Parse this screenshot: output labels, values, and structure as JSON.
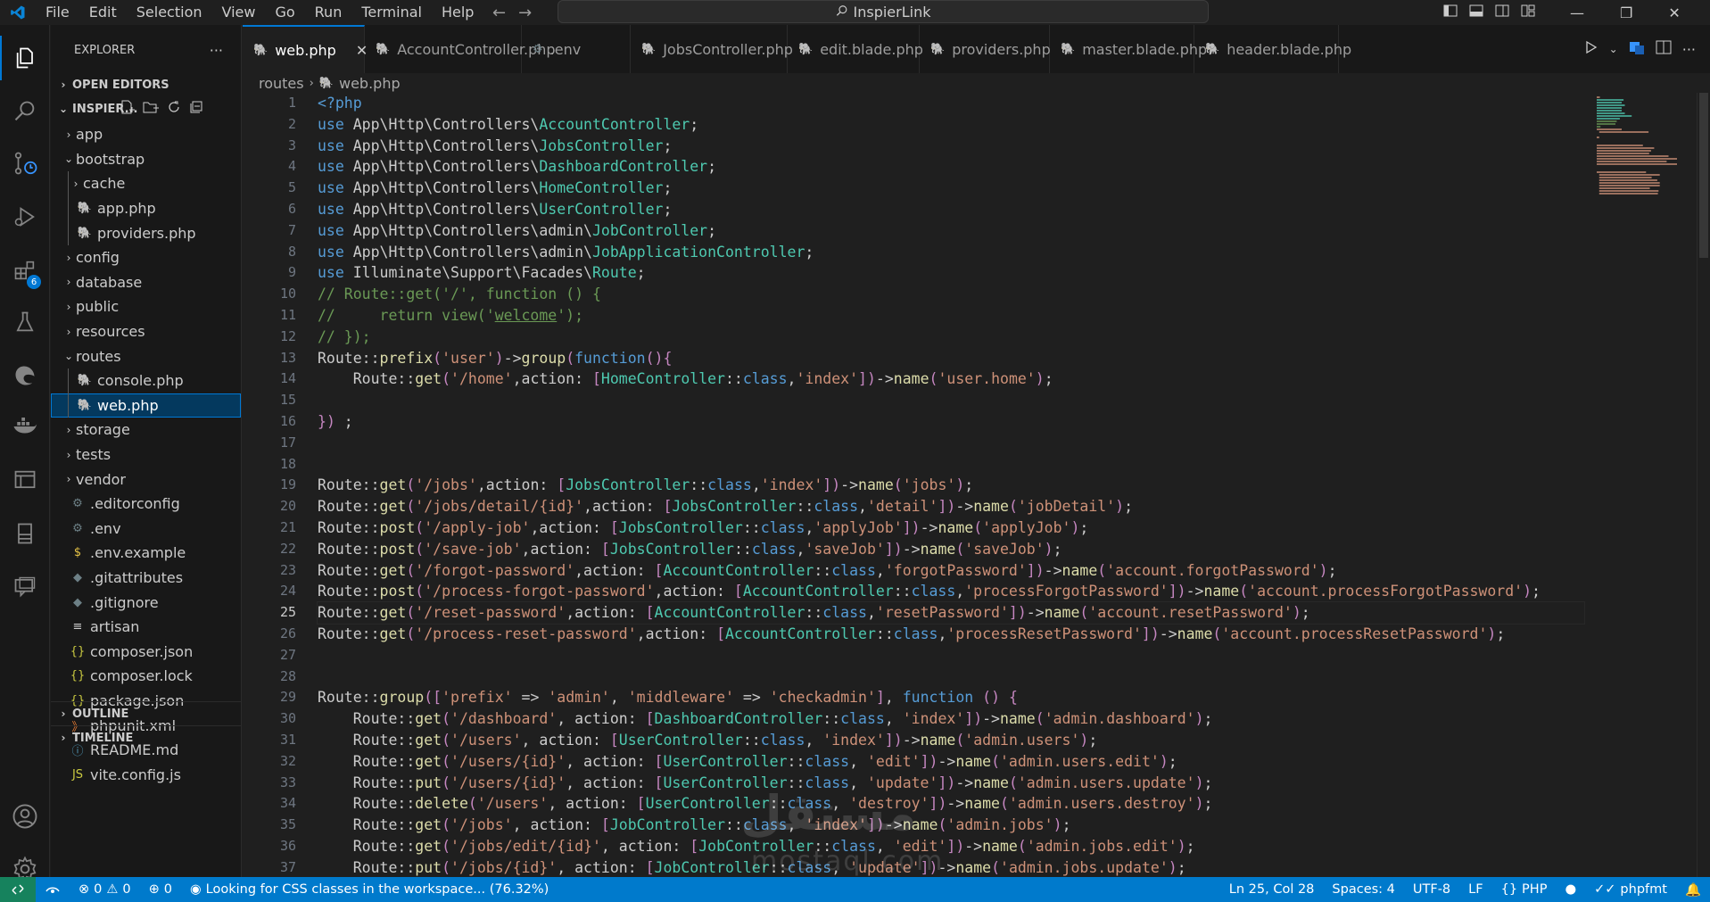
{
  "titlebar": {
    "menu": [
      "File",
      "Edit",
      "Selection",
      "View",
      "Go",
      "Run",
      "Terminal",
      "Help"
    ],
    "search_text": "InspierLink"
  },
  "activitybar": {
    "items": [
      "explorer-icon",
      "search-icon",
      "source-control-icon",
      "run-debug-icon",
      "extensions-icon",
      "testing-icon",
      "edge-icon",
      "docker-icon",
      "remote-explorer-icon",
      "database-icon",
      "chat-icon"
    ],
    "extensions_badge": "6",
    "bottom": [
      "account-icon",
      "settings-gear-icon"
    ]
  },
  "sidebar": {
    "title": "EXPLORER",
    "more": "···",
    "open_editors": "OPEN EDITORS",
    "folder": "INSPIER...",
    "tree": [
      {
        "label": "app",
        "type": "folder",
        "open": false,
        "depth": 0
      },
      {
        "label": "bootstrap",
        "type": "folder",
        "open": true,
        "depth": 0
      },
      {
        "label": "cache",
        "type": "folder",
        "open": false,
        "depth": 1
      },
      {
        "label": "app.php",
        "type": "php",
        "depth": 1
      },
      {
        "label": "providers.php",
        "type": "php",
        "depth": 1
      },
      {
        "label": "config",
        "type": "folder",
        "open": false,
        "depth": 0
      },
      {
        "label": "database",
        "type": "folder",
        "open": false,
        "depth": 0
      },
      {
        "label": "public",
        "type": "folder",
        "open": false,
        "depth": 0
      },
      {
        "label": "resources",
        "type": "folder",
        "open": false,
        "depth": 0
      },
      {
        "label": "routes",
        "type": "folder",
        "open": true,
        "depth": 0
      },
      {
        "label": "console.php",
        "type": "php",
        "depth": 1
      },
      {
        "label": "web.php",
        "type": "php",
        "depth": 1,
        "selected": true
      },
      {
        "label": "storage",
        "type": "folder",
        "open": false,
        "depth": 0
      },
      {
        "label": "tests",
        "type": "folder",
        "open": false,
        "depth": 0
      },
      {
        "label": "vendor",
        "type": "folder",
        "open": false,
        "depth": 0
      },
      {
        "label": ".editorconfig",
        "type": "gear",
        "depth": 0
      },
      {
        "label": ".env",
        "type": "gear",
        "depth": 0
      },
      {
        "label": ".env.example",
        "type": "dollar",
        "depth": 0
      },
      {
        "label": ".gitattributes",
        "type": "git",
        "depth": 0
      },
      {
        "label": ".gitignore",
        "type": "git",
        "depth": 0
      },
      {
        "label": "artisan",
        "type": "lines",
        "depth": 0
      },
      {
        "label": "composer.json",
        "type": "json",
        "depth": 0
      },
      {
        "label": "composer.lock",
        "type": "json",
        "depth": 0
      },
      {
        "label": "package.json",
        "type": "json",
        "depth": 0
      },
      {
        "label": "phpunit.xml",
        "type": "rss",
        "depth": 0
      },
      {
        "label": "README.md",
        "type": "info",
        "depth": 0
      },
      {
        "label": "vite.config.js",
        "type": "js",
        "depth": 0
      }
    ],
    "outline": "OUTLINE",
    "timeline": "TIMELINE"
  },
  "tabs": [
    {
      "label": "web.php",
      "active": true,
      "type": "php"
    },
    {
      "label": "AccountController.php",
      "type": "php"
    },
    {
      "label": ".env",
      "type": "gear"
    },
    {
      "label": "JobsController.php",
      "type": "php"
    },
    {
      "label": "edit.blade.php",
      "type": "php"
    },
    {
      "label": "providers.php",
      "type": "php"
    },
    {
      "label": "master.blade.php",
      "type": "php"
    },
    {
      "label": "header.blade.php",
      "type": "php"
    }
  ],
  "breadcrumb": {
    "folder": "routes",
    "file": "web.php"
  },
  "editor": {
    "current_line": 25,
    "lines": [
      "<?php",
      "use App\\Http\\Controllers\\AccountController;",
      "use App\\Http\\Controllers\\JobsController;",
      "use App\\Http\\Controllers\\DashboardController;",
      "use App\\Http\\Controllers\\HomeController;",
      "use App\\Http\\Controllers\\UserController;",
      "use App\\Http\\Controllers\\admin\\JobController;",
      "use App\\Http\\Controllers\\admin\\JobApplicationController;",
      "use Illuminate\\Support\\Facades\\Route;",
      "// Route::get('/', function () {",
      "//     return view('welcome');",
      "// });",
      "Route::prefix('user')->group(function(){",
      "    Route::get('/home',action: [HomeController::class,'index'])->name('user.home');",
      "",
      "}) ;",
      "",
      "",
      "Route::get('/jobs',action: [JobsController::class,'index'])->name('jobs');",
      "Route::get('/jobs/detail/{id}',action: [JobsController::class,'detail'])->name('jobDetail');",
      "Route::post('/apply-job',action: [JobsController::class,'applyJob'])->name('applyJob');",
      "Route::post('/save-job',action: [JobsController::class,'saveJob'])->name('saveJob');",
      "Route::get('/forgot-password',action: [AccountController::class,'forgotPassword'])->name('account.forgotPassword');",
      "Route::post('/process-forgot-password',action: [AccountController::class,'processForgotPassword'])->name('account.processForgotPassword');",
      "Route::get('/reset-password',action: [AccountController::class,'resetPassword'])->name('account.resetPassword');",
      "Route::get('/process-reset-password',action: [AccountController::class,'processResetPassword'])->name('account.processResetPassword');",
      "",
      "",
      "Route::group(['prefix' => 'admin', 'middleware' => 'checkadmin'], function () {",
      "    Route::get('/dashboard', action: [DashboardController::class, 'index'])->name('admin.dashboard');",
      "    Route::get('/users', action: [UserController::class, 'index'])->name('admin.users');",
      "    Route::get('/users/{id}', action: [UserController::class, 'edit'])->name('admin.users.edit');",
      "    Route::put('/users/{id}', action: [UserController::class, 'update'])->name('admin.users.update');",
      "    Route::delete('/users', action: [UserController::class, 'destroy'])->name('admin.users.destroy');",
      "    Route::get('/jobs', action: [JobController::class, 'index'])->name('admin.jobs');",
      "    Route::get('/jobs/edit/{id}', action: [JobController::class, 'edit'])->name('admin.jobs.edit');",
      "    Route::put('/jobs/{id}', action: [JobController::class, 'update'])->name('admin.jobs.update');"
    ]
  },
  "watermark": {
    "line1": "مستقل",
    "line2": "mostaql.com"
  },
  "statusbar": {
    "errors": "0",
    "warnings": "0",
    "ports": "0",
    "message": "Looking for CSS classes in the workspace... (76.32%)",
    "position": "Ln 25, Col 28",
    "spaces": "Spaces: 4",
    "encoding": "UTF-8",
    "eol": "LF",
    "language": "PHP",
    "formatter": "phpfmt"
  },
  "colors": {
    "accent": "#007acc",
    "keyword": "#569cd6",
    "type": "#4ec9b0",
    "string": "#ce9178",
    "comment": "#6a9955",
    "function": "#dcdcaa",
    "php_icon": "#a074c4"
  }
}
